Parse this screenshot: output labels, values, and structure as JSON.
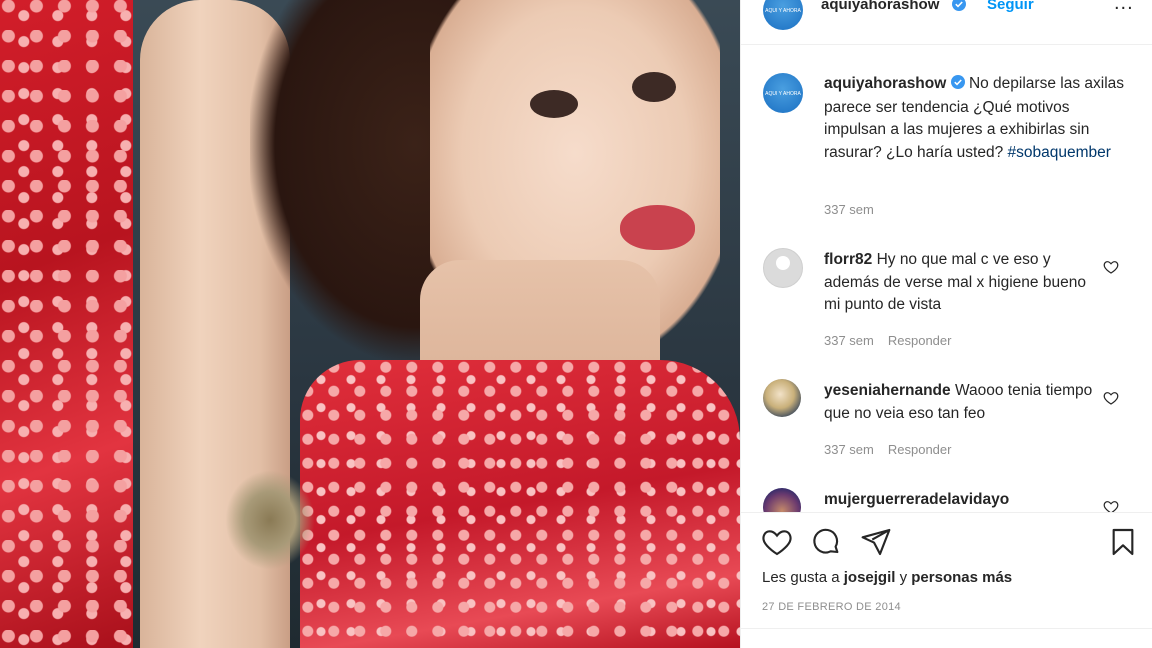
{
  "post": {
    "username": "aquiyahorashow",
    "follow_label": "Seguir",
    "more_label": "...",
    "avatar_text": "AQUI Y AHORA",
    "caption_text": "No depilarse las axilas parece ser tendencia ¿Qué motivos impulsan a las mujeres a exhibirlas sin rasurar? ¿Lo haría usted?",
    "hashtag": "#sobaquember",
    "caption_time": "337 sem"
  },
  "comments": [
    {
      "username": "florr82",
      "text": "Hy no que mal c ve eso y además de verse mal x higiene bueno mi punto de vista",
      "time": "337 sem",
      "reply": "Responder"
    },
    {
      "username": "yeseniahernande",
      "text": "Waooo tenia tiempo que no veia eso tan feo",
      "time": "337 sem",
      "reply": "Responder"
    },
    {
      "username": "mujerguerreradelavidayo",
      "text": "",
      "time": "",
      "reply": ""
    }
  ],
  "footer": {
    "likes_prefix": "Les gusta a",
    "likes_user": "josejgil",
    "likes_conj": "y",
    "likes_suffix": "personas más",
    "date": "27 DE FEBRERO DE 2014"
  },
  "icons": [
    "verified-icon",
    "more-icon",
    "heart-icon",
    "comment-icon",
    "share-icon",
    "bookmark-icon"
  ],
  "colors": {
    "link": "#0095f6",
    "hashtag": "#00376b",
    "muted": "#8e8e8e",
    "verified": "#3897f0"
  }
}
